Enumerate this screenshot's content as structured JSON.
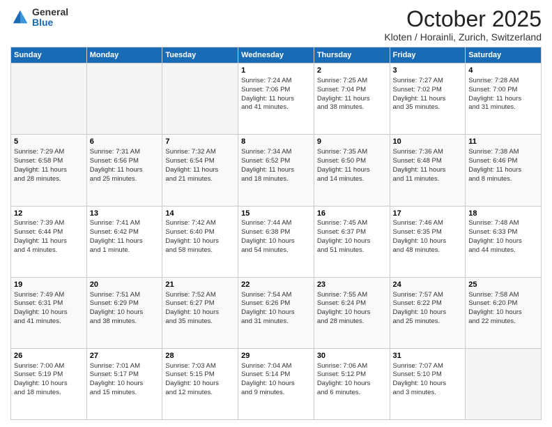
{
  "header": {
    "logo_general": "General",
    "logo_blue": "Blue",
    "month_title": "October 2025",
    "location": "Kloten / Horainli, Zurich, Switzerland"
  },
  "weekdays": [
    "Sunday",
    "Monday",
    "Tuesday",
    "Wednesday",
    "Thursday",
    "Friday",
    "Saturday"
  ],
  "weeks": [
    [
      {
        "day": "",
        "info": ""
      },
      {
        "day": "",
        "info": ""
      },
      {
        "day": "",
        "info": ""
      },
      {
        "day": "1",
        "info": "Sunrise: 7:24 AM\nSunset: 7:06 PM\nDaylight: 11 hours\nand 41 minutes."
      },
      {
        "day": "2",
        "info": "Sunrise: 7:25 AM\nSunset: 7:04 PM\nDaylight: 11 hours\nand 38 minutes."
      },
      {
        "day": "3",
        "info": "Sunrise: 7:27 AM\nSunset: 7:02 PM\nDaylight: 11 hours\nand 35 minutes."
      },
      {
        "day": "4",
        "info": "Sunrise: 7:28 AM\nSunset: 7:00 PM\nDaylight: 11 hours\nand 31 minutes."
      }
    ],
    [
      {
        "day": "5",
        "info": "Sunrise: 7:29 AM\nSunset: 6:58 PM\nDaylight: 11 hours\nand 28 minutes."
      },
      {
        "day": "6",
        "info": "Sunrise: 7:31 AM\nSunset: 6:56 PM\nDaylight: 11 hours\nand 25 minutes."
      },
      {
        "day": "7",
        "info": "Sunrise: 7:32 AM\nSunset: 6:54 PM\nDaylight: 11 hours\nand 21 minutes."
      },
      {
        "day": "8",
        "info": "Sunrise: 7:34 AM\nSunset: 6:52 PM\nDaylight: 11 hours\nand 18 minutes."
      },
      {
        "day": "9",
        "info": "Sunrise: 7:35 AM\nSunset: 6:50 PM\nDaylight: 11 hours\nand 14 minutes."
      },
      {
        "day": "10",
        "info": "Sunrise: 7:36 AM\nSunset: 6:48 PM\nDaylight: 11 hours\nand 11 minutes."
      },
      {
        "day": "11",
        "info": "Sunrise: 7:38 AM\nSunset: 6:46 PM\nDaylight: 11 hours\nand 8 minutes."
      }
    ],
    [
      {
        "day": "12",
        "info": "Sunrise: 7:39 AM\nSunset: 6:44 PM\nDaylight: 11 hours\nand 4 minutes."
      },
      {
        "day": "13",
        "info": "Sunrise: 7:41 AM\nSunset: 6:42 PM\nDaylight: 11 hours\nand 1 minute."
      },
      {
        "day": "14",
        "info": "Sunrise: 7:42 AM\nSunset: 6:40 PM\nDaylight: 10 hours\nand 58 minutes."
      },
      {
        "day": "15",
        "info": "Sunrise: 7:44 AM\nSunset: 6:38 PM\nDaylight: 10 hours\nand 54 minutes."
      },
      {
        "day": "16",
        "info": "Sunrise: 7:45 AM\nSunset: 6:37 PM\nDaylight: 10 hours\nand 51 minutes."
      },
      {
        "day": "17",
        "info": "Sunrise: 7:46 AM\nSunset: 6:35 PM\nDaylight: 10 hours\nand 48 minutes."
      },
      {
        "day": "18",
        "info": "Sunrise: 7:48 AM\nSunset: 6:33 PM\nDaylight: 10 hours\nand 44 minutes."
      }
    ],
    [
      {
        "day": "19",
        "info": "Sunrise: 7:49 AM\nSunset: 6:31 PM\nDaylight: 10 hours\nand 41 minutes."
      },
      {
        "day": "20",
        "info": "Sunrise: 7:51 AM\nSunset: 6:29 PM\nDaylight: 10 hours\nand 38 minutes."
      },
      {
        "day": "21",
        "info": "Sunrise: 7:52 AM\nSunset: 6:27 PM\nDaylight: 10 hours\nand 35 minutes."
      },
      {
        "day": "22",
        "info": "Sunrise: 7:54 AM\nSunset: 6:26 PM\nDaylight: 10 hours\nand 31 minutes."
      },
      {
        "day": "23",
        "info": "Sunrise: 7:55 AM\nSunset: 6:24 PM\nDaylight: 10 hours\nand 28 minutes."
      },
      {
        "day": "24",
        "info": "Sunrise: 7:57 AM\nSunset: 6:22 PM\nDaylight: 10 hours\nand 25 minutes."
      },
      {
        "day": "25",
        "info": "Sunrise: 7:58 AM\nSunset: 6:20 PM\nDaylight: 10 hours\nand 22 minutes."
      }
    ],
    [
      {
        "day": "26",
        "info": "Sunrise: 7:00 AM\nSunset: 5:19 PM\nDaylight: 10 hours\nand 18 minutes."
      },
      {
        "day": "27",
        "info": "Sunrise: 7:01 AM\nSunset: 5:17 PM\nDaylight: 10 hours\nand 15 minutes."
      },
      {
        "day": "28",
        "info": "Sunrise: 7:03 AM\nSunset: 5:15 PM\nDaylight: 10 hours\nand 12 minutes."
      },
      {
        "day": "29",
        "info": "Sunrise: 7:04 AM\nSunset: 5:14 PM\nDaylight: 10 hours\nand 9 minutes."
      },
      {
        "day": "30",
        "info": "Sunrise: 7:06 AM\nSunset: 5:12 PM\nDaylight: 10 hours\nand 6 minutes."
      },
      {
        "day": "31",
        "info": "Sunrise: 7:07 AM\nSunset: 5:10 PM\nDaylight: 10 hours\nand 3 minutes."
      },
      {
        "day": "",
        "info": ""
      }
    ]
  ]
}
